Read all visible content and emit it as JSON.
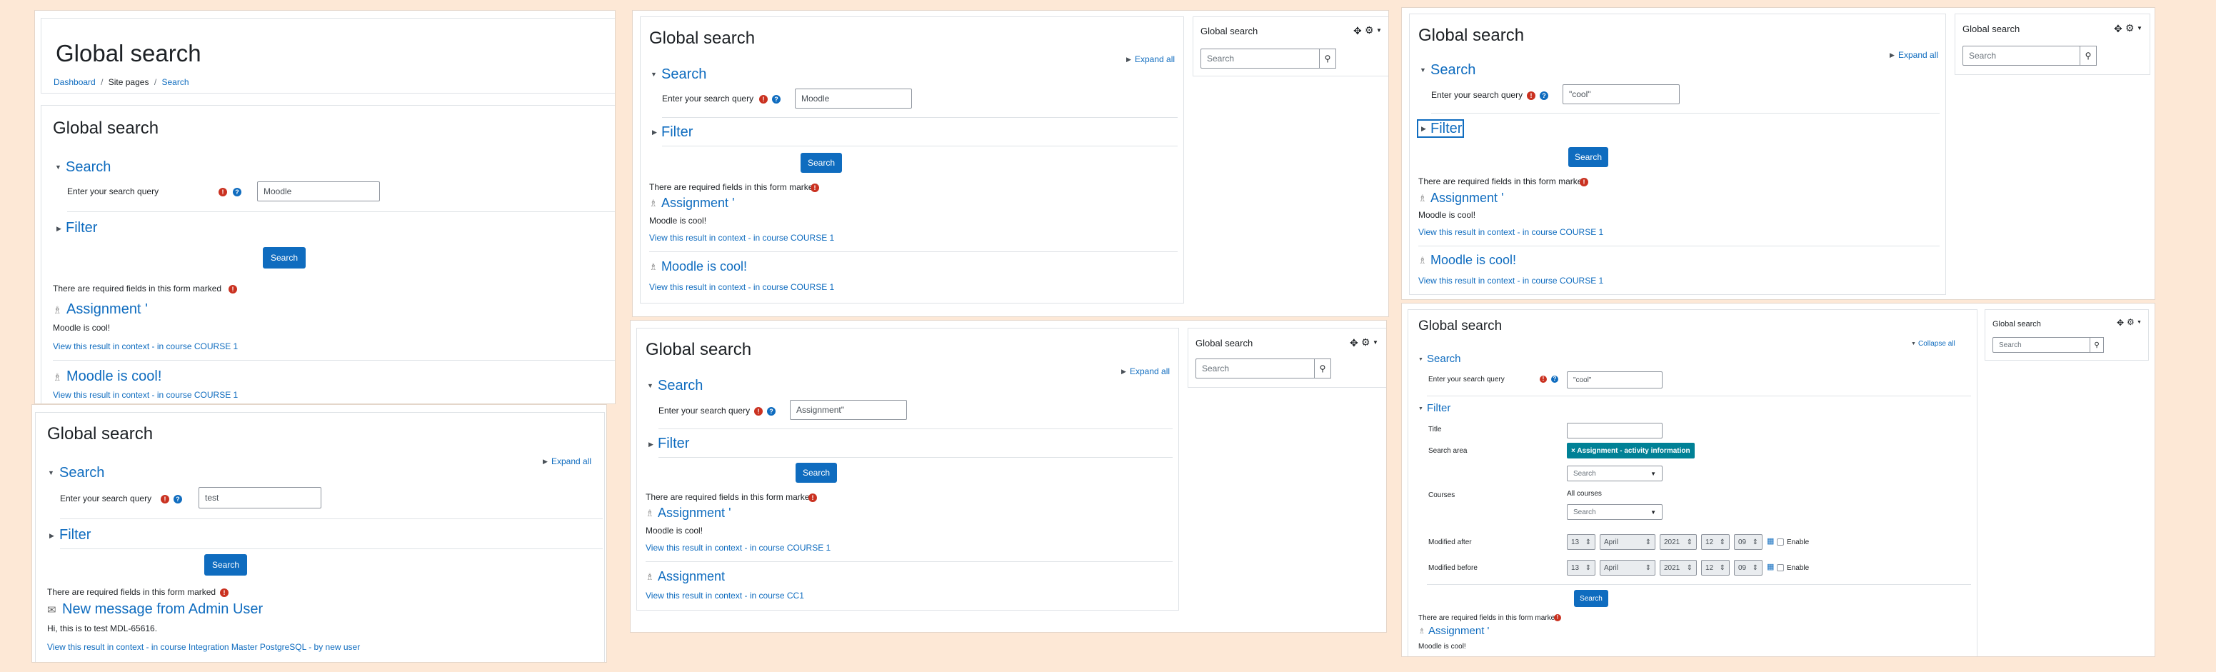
{
  "page": {
    "title": "Global search"
  },
  "breadcrumb": {
    "dashboard": "Dashboard",
    "sep": "/",
    "site_pages": "Site pages",
    "search": "Search"
  },
  "form": {
    "search_legend": "Search",
    "query_label": "Enter your search query",
    "filter_legend": "Filter",
    "search_button": "Search",
    "required_note": "There are required fields in this form marked",
    "expand_all": "Expand all",
    "collapse_all": "Collapse all"
  },
  "block": {
    "title": "Global search",
    "search_placeholder": "Search"
  },
  "icons": {
    "required": "exclamation-icon",
    "help": "question-icon",
    "move": "move-icon",
    "gear": "gear-icon",
    "search": "search-icon",
    "calendar": "calendar-icon"
  },
  "colors": {
    "primary": "#0f6cbf",
    "danger": "#ca3120",
    "tag": "#008196",
    "background": "#fde8d6"
  },
  "results": {
    "assignment": "Assignment",
    "assignment_mark": "'",
    "moodle_cool_text": "Moodle is cool!",
    "moodle_cool_title": "Moodle is cool!",
    "view_in_context": "View this result in context",
    "dash": " - ",
    "in_course_1": "in course COURSE 1",
    "in_course_cc1": "in course CC1",
    "message_title": "New message from Admin User",
    "message_text": "Hi, this is to test MDL-65616.",
    "in_course_integration": "in course Integration Master PostgreSQL",
    "by_new_user": "by new user"
  },
  "queries": {
    "moodle": "Moodle",
    "test": "test",
    "assignment": "Assignment\"",
    "cool": "\"cool\""
  },
  "filter": {
    "title_label": "Title",
    "area_label": "Search area",
    "area_tag": "× Assignment - activity information",
    "search_placeholder": "Search",
    "courses_label": "Courses",
    "all_courses": "All courses",
    "modified_after": "Modified after",
    "modified_before": "Modified before",
    "day": "13",
    "month": "April",
    "year": "2021",
    "hour": "12",
    "minute": "09",
    "enable": "Enable"
  }
}
